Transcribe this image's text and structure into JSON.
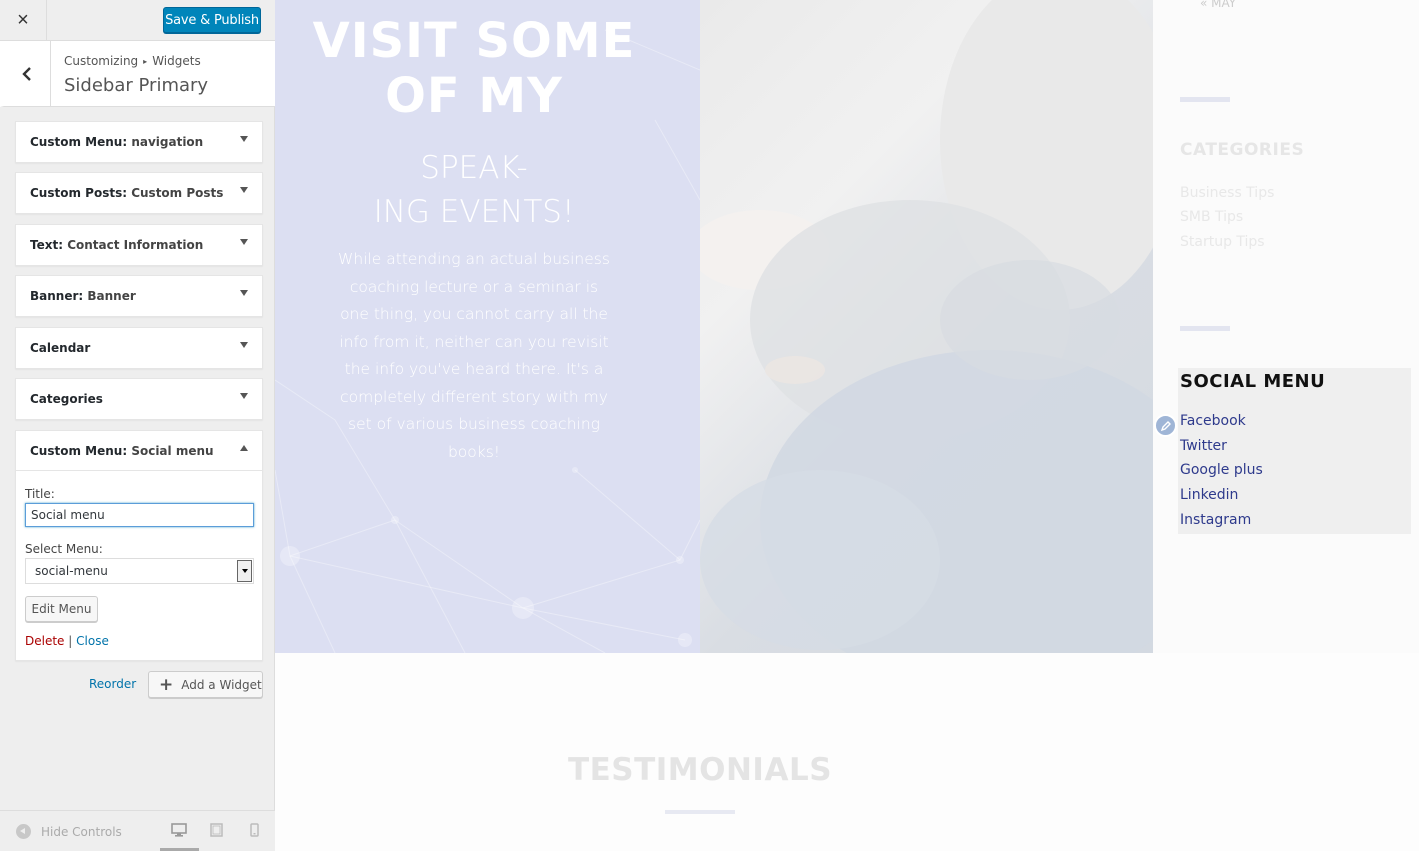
{
  "customizer": {
    "close_icon": "×",
    "publish_label": "Save & Publish",
    "breadcrumb": {
      "first": "Customizing",
      "separator": "▸",
      "second": "Widgets"
    },
    "section_title": "Sidebar Primary",
    "widgets": [
      {
        "type": "Custom Menu",
        "name": "navigation",
        "expanded": false
      },
      {
        "type": "Custom Posts",
        "name": "Custom Posts",
        "expanded": false
      },
      {
        "type": "Text",
        "name": "Contact Information",
        "expanded": false
      },
      {
        "type": "Banner",
        "name": "Banner",
        "expanded": false
      },
      {
        "type": "Calendar",
        "name": "",
        "expanded": false
      },
      {
        "type": "Categories",
        "name": "",
        "expanded": false
      },
      {
        "type": "Custom Menu",
        "name": "Social menu",
        "expanded": true
      }
    ],
    "open_widget": {
      "title_label": "Title:",
      "title_value": "Social menu",
      "select_label": "Select Menu:",
      "select_value": "social-menu",
      "edit_menu_label": "Edit Menu",
      "delete_label": "Delete",
      "actions_separator": "|",
      "close_label": "Close"
    },
    "reorder_label": "Reorder",
    "add_widget_icon": "+",
    "add_widget_label": "Add a Widget",
    "hide_controls_label": "Hide Controls",
    "devices": [
      "desktop-icon",
      "tablet-icon",
      "mobile-icon"
    ],
    "active_device": "desktop"
  },
  "preview": {
    "hero_heading_line1": "VISIT SOME",
    "hero_heading_line2": "OF MY",
    "hero_sub_line1": "SPEAK-",
    "hero_sub_line2": "ING EVENTS!",
    "hero_text_lines": [
      "While attending an actual business",
      "coaching lecture or a seminar is",
      "one thing, you cannot carry all the",
      "info from it, neither can you revisit",
      "the info you've heard there. It's a",
      "completely different story with my",
      "set of various business coaching",
      "books!"
    ],
    "sidebar": {
      "may_link": "« MAY",
      "categories_heading": "CATEGORIES",
      "categories": [
        "Business Tips",
        "SMB Tips",
        "Startup Tips"
      ],
      "social_heading": "SOCIAL MENU",
      "social_items": [
        "Facebook",
        "Twitter",
        "Google plus",
        "Linkedin",
        "Instagram"
      ]
    },
    "testimonials_heading": "TESTIMONIALS"
  },
  "colors": {
    "publish_button": "#0085ba",
    "link": "#0073aa",
    "delete_link": "#a00000",
    "hero_overlay": "#dcdff2",
    "social_link": "#2e3a8c"
  }
}
